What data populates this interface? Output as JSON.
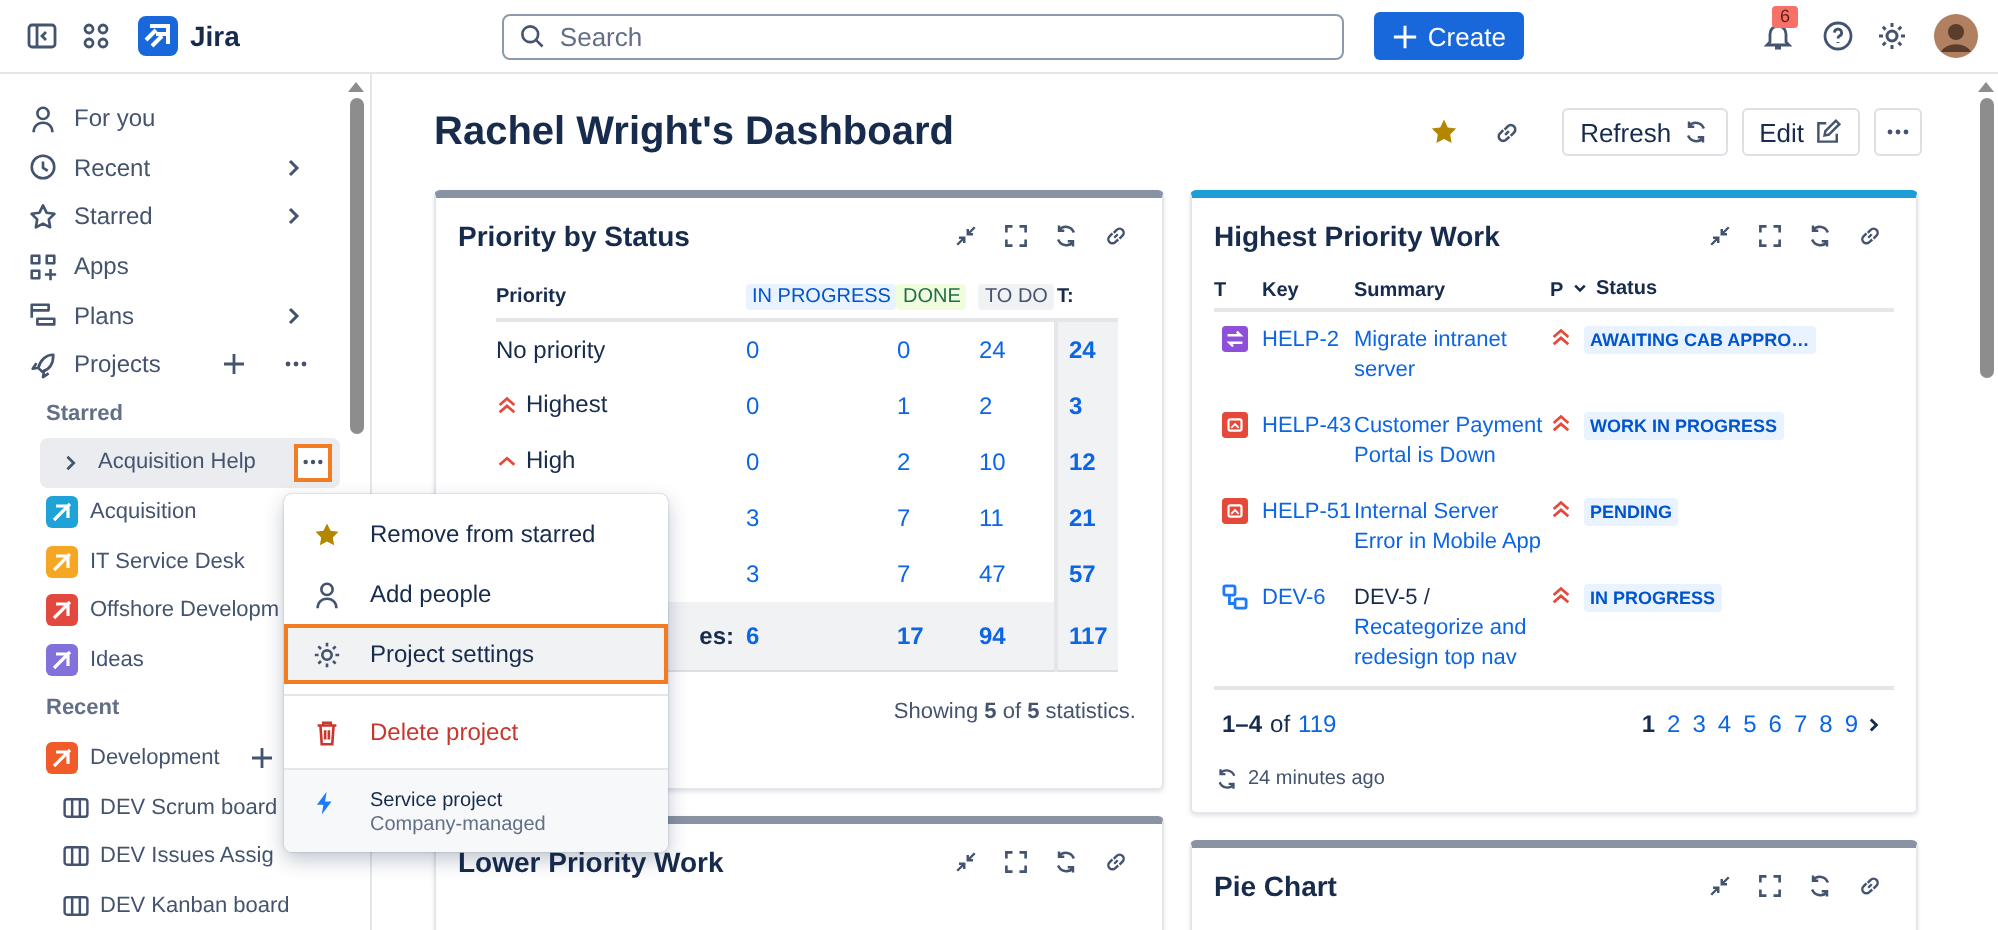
{
  "topbar": {
    "product": "Jira",
    "search": {
      "placeholder": "Search"
    },
    "create_button": "Create",
    "notifications_badge": "6"
  },
  "sidebar": {
    "nav": [
      {
        "label": "For you",
        "kind": "person",
        "chevron": false,
        "actions": false
      },
      {
        "label": "Recent",
        "kind": "clock",
        "chevron": true,
        "actions": false
      },
      {
        "label": "Starred",
        "kind": "star",
        "chevron": true,
        "actions": false
      },
      {
        "label": "Apps",
        "kind": "apps",
        "chevron": false,
        "actions": false
      },
      {
        "label": "Plans",
        "kind": "plans",
        "chevron": true,
        "actions": false
      },
      {
        "label": "Projects",
        "kind": "rocket",
        "chevron": false,
        "actions": true
      }
    ],
    "sections": [
      {
        "heading": "Starred",
        "items": [
          {
            "label": "Acquisition Help",
            "kind": "collapsed",
            "selected": true,
            "menu_open": true
          },
          {
            "label": "Acquisition",
            "kind": "project",
            "color": "#1fa2d6",
            "selected": false,
            "menu_open": false
          },
          {
            "label": "IT Service Desk",
            "kind": "project",
            "color": "#f5a623",
            "selected": false,
            "menu_open": false
          },
          {
            "label": "Offshore Developm",
            "kind": "project",
            "color": "#e2483d",
            "selected": false,
            "menu_open": false
          },
          {
            "label": "Ideas",
            "kind": "project",
            "color": "#8270db",
            "selected": false,
            "menu_open": false
          }
        ]
      },
      {
        "heading": "Recent",
        "items": [
          {
            "label": "Development",
            "kind": "project",
            "color": "#f15b2a",
            "selected": false,
            "menu_open": false,
            "add": true,
            "children": [
              {
                "label": "DEV Scrum board",
                "kind": "board",
                "selected": false
              },
              {
                "label": "DEV Issues Assig",
                "kind": "board",
                "selected": false
              },
              {
                "label": "DEV Kanban board",
                "kind": "board",
                "selected": false
              }
            ]
          }
        ]
      }
    ]
  },
  "context_menu": {
    "items": [
      {
        "label": "Remove from starred",
        "kind": "star",
        "selected": false
      },
      {
        "label": "Add people",
        "kind": "person",
        "selected": false
      },
      {
        "label": "Project settings",
        "kind": "gear",
        "selected": true
      },
      {
        "label": "Delete project",
        "kind": "trash",
        "selected": false
      }
    ],
    "footer": {
      "title": "Service project",
      "subtitle": "Company-managed"
    }
  },
  "dashboard": {
    "title": "Rachel Wright's Dashboard",
    "starred": true,
    "refresh_button": "Refresh",
    "edit_button": "Edit"
  },
  "priority_gadget": {
    "title": "Priority by Status",
    "color": "#8993a4",
    "columns": [
      {
        "label": "Priority",
        "kind": "plain"
      },
      {
        "label": "IN PROGRESS",
        "kind": "blue"
      },
      {
        "label": "DONE",
        "kind": "green"
      },
      {
        "label": "TO DO",
        "kind": "grey"
      },
      {
        "label": "T:",
        "kind": "plain"
      }
    ],
    "rows": [
      {
        "kind": "none",
        "label": "No priority",
        "values": [
          "0",
          "0",
          "24"
        ],
        "total": "24"
      },
      {
        "kind": "highest",
        "label": "Highest",
        "values": [
          "0",
          "1",
          "2"
        ],
        "total": "3"
      },
      {
        "kind": "high",
        "label": "High",
        "values": [
          "0",
          "2",
          "10"
        ],
        "total": "12"
      },
      {
        "values": [
          "3",
          "7",
          "11"
        ],
        "total": "21"
      },
      {
        "values": [
          "3",
          "7",
          "47"
        ],
        "total": "57"
      }
    ],
    "footer": {
      "label": "es:",
      "values": [
        "6",
        "17",
        "94"
      ],
      "total": "117"
    },
    "summary": "Showing **5** of **5** statistics."
  },
  "work_gadget": {
    "title": "Highest Priority Work",
    "color": "#1d9ed6",
    "columns": [
      {
        "label": "T",
        "sorted": false
      },
      {
        "label": "Key",
        "sorted": false
      },
      {
        "label": "Summary",
        "sorted": false
      },
      {
        "label": "P",
        "sorted": false
      },
      {
        "label": "Status",
        "sorted": true
      }
    ],
    "rows": [
      {
        "kind": "change",
        "key": "HELP-2",
        "summary": "Migrate intranet server",
        "priority": {
          "kind": "highest"
        },
        "status": "AWAITING CAB APPRO…"
      },
      {
        "kind": "incident",
        "key": "HELP-43",
        "summary": "Customer Payment Portal is Down",
        "priority": {
          "kind": "highest"
        },
        "status": "WORK IN PROGRESS"
      },
      {
        "kind": "incident",
        "key": "HELP-51",
        "summary": "Internal Server Error in Mobile App",
        "priority": {
          "kind": "highest"
        },
        "status": "PENDING"
      },
      {
        "kind": "subtask",
        "key": "DEV-6",
        "parent": "DEV-5 /",
        "summary": "Recategorize and redesign top nav",
        "priority": {
          "kind": "highest"
        },
        "status": "IN PROGRESS"
      }
    ],
    "range": "1–4",
    "of": "of",
    "total": "119",
    "pages": [
      {
        "label": "1",
        "selected": true
      },
      {
        "label": "2",
        "selected": false
      },
      {
        "label": "3",
        "selected": false
      },
      {
        "label": "4",
        "selected": false
      },
      {
        "label": "5",
        "selected": false
      },
      {
        "label": "6",
        "selected": false
      },
      {
        "label": "7",
        "selected": false
      },
      {
        "label": "8",
        "selected": false
      },
      {
        "label": "9",
        "selected": false
      }
    ],
    "updated": "24 minutes ago"
  },
  "lower_gadgets": [
    {
      "title": "Lower Priority Work",
      "color": "#8993a4"
    },
    {
      "title": "Pie Chart",
      "color": "#8993a4"
    }
  ]
}
